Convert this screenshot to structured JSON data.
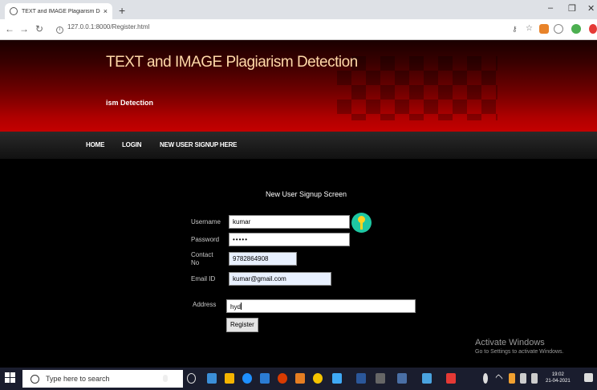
{
  "browser": {
    "tab_title": "TEXT and IMAGE Plagiarism Detec",
    "tab_close": "×",
    "new_tab": "+",
    "url": "127.0.0.1:8000/Register.html",
    "win_min": "–",
    "win_max": "❐",
    "win_close": "✕"
  },
  "site": {
    "title": "TEXT and IMAGE Plagiarism Detection",
    "subtitle": "ism Detection"
  },
  "menu": [
    {
      "label": "HOME"
    },
    {
      "label": "LOGIN"
    },
    {
      "label": "NEW USER SIGNUP HERE"
    }
  ],
  "form": {
    "title": "New User Signup Screen",
    "username_label": "Username",
    "username_value": "kumar",
    "password_label": "Password",
    "password_value": "•••••",
    "contact_label": "Contact\nNo",
    "contact_value": "9782864908",
    "email_label": "Email ID",
    "email_value": "kumar@gmail.com",
    "address_label": "Address",
    "address_value": "hyd",
    "register_label": "Register"
  },
  "watermark": {
    "line1": "Activate Windows",
    "line2": "Go to Settings to activate Windows."
  },
  "taskbar": {
    "search_placeholder": "Type here to search",
    "time": "19:02",
    "date": "21-04-2021"
  },
  "colors": {
    "header_red": "#c40000",
    "title_color": "#ffd9a8",
    "key_icon": "#1ec8a2"
  }
}
